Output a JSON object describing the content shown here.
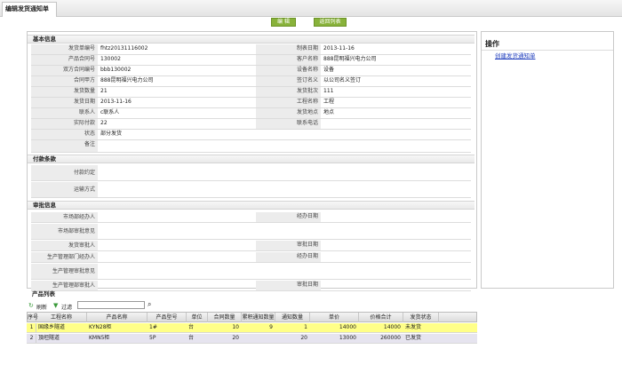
{
  "tab": {
    "title": "编辑发货通知单"
  },
  "toolbar": {
    "edit_label": "编 辑",
    "back_label": "返回列表"
  },
  "basic": {
    "title": "基本信息",
    "rows": [
      {
        "l1": "发货单编号",
        "v1": "fhtz20131116002",
        "l2": "制表日期",
        "v2": "2013-11-16"
      },
      {
        "l1": "产品合同号",
        "v1": "130002",
        "l2": "客户名称",
        "v2": "888昆明福兴电力公司"
      },
      {
        "l1": "双方合同编号",
        "v1": "bbb130002",
        "l2": "设备名称",
        "v2": "设备"
      },
      {
        "l1": "合同甲方",
        "v1": "888昆明福兴电力公司",
        "l2": "签订名义",
        "v2": "以公司名义签订"
      },
      {
        "l1": "发货数量",
        "v1": "21",
        "l2": "发货批次",
        "v2": "111"
      },
      {
        "l1": "发货日期",
        "v1": "2013-11-16",
        "l2": "工程名称",
        "v2": "工程"
      },
      {
        "l1": "联系人",
        "v1": "c联系人",
        "l2": "发货地点",
        "v2": "地点"
      },
      {
        "l1": "实际付款",
        "v1": "22",
        "l2": "联系电话",
        "v2": ""
      },
      {
        "l1": "状态",
        "v1": "部分发货",
        "l2": "",
        "v2": ""
      },
      {
        "l1": "备注",
        "v1": "",
        "l2": "",
        "v2": ""
      }
    ]
  },
  "payment": {
    "title": "付款条款",
    "terms_label": "付款约定",
    "ship_label": "运输方式"
  },
  "approval": {
    "title": "审批信息",
    "rows": [
      {
        "l1": "市场部经办人",
        "l2": "经办日期",
        "full": false
      },
      {
        "l1": "市场部审批意见",
        "full": true
      },
      {
        "l1": "发货审批人",
        "l2": "审批日期",
        "full": false
      },
      {
        "l1": "生产管理部门经办人",
        "l2": "经办日期",
        "full": false
      },
      {
        "l1": "生产管理审批意见",
        "full": true
      },
      {
        "l1": "生产管理部审批人",
        "l2": "审批日期",
        "full": false
      }
    ]
  },
  "products": {
    "title": "产品列表",
    "refresh_label": "刷新",
    "filter_label": "过滤",
    "columns": [
      "序号",
      "工程名称",
      "产品名称",
      "产品型号",
      "单位",
      "合同数量",
      "累积通知数量",
      "通知数量",
      "单价",
      "价格合计",
      "发货状态"
    ],
    "rows": [
      [
        "1",
        "国缘乡隧道",
        "KYN28柜",
        "1#",
        "台",
        "10",
        "9",
        "1",
        "14000",
        "14000",
        "未发货"
      ],
      [
        "2",
        "頂坦隧道",
        "KMN5柜",
        "5P",
        "台",
        "20",
        "",
        "20",
        "13000",
        "260000",
        "已发货"
      ]
    ],
    "colors": {
      "row1_bg": "#ffff88",
      "row2_bg": "#e6e4ef"
    }
  },
  "side": {
    "title": "操作",
    "link": "创建发货通知单"
  },
  "colors": {
    "button_green": "#88b23a",
    "link_blue": "#1f3dbd"
  }
}
